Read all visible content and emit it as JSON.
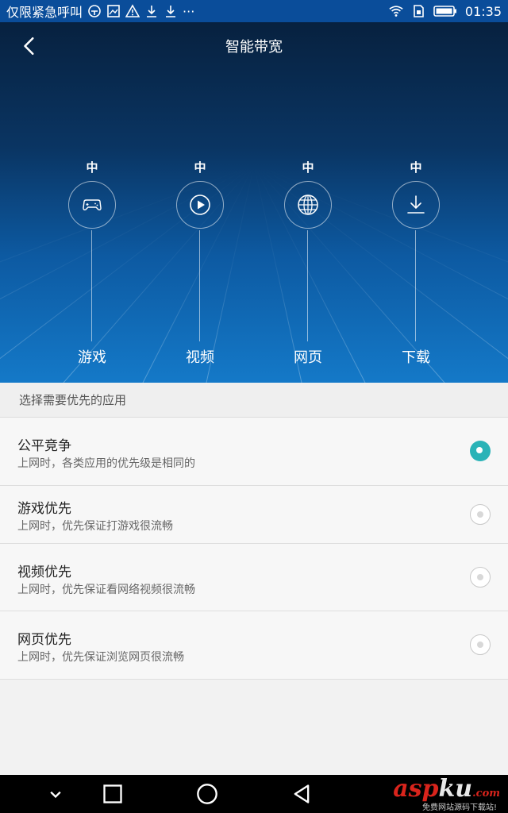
{
  "status_bar": {
    "left_text": "仅限紧急呼叫",
    "time": "01:35",
    "icons": [
      "location-icon",
      "image-icon",
      "warning-icon",
      "download-icon",
      "download-icon",
      "more-icon",
      "wifi-icon",
      "sim-icon",
      "battery-icon"
    ],
    "more": "···"
  },
  "header": {
    "title": "智能带宽",
    "back_icon": "chevron-left-icon"
  },
  "apps": [
    {
      "level": "中",
      "label": "游戏",
      "icon": "gamepad-icon"
    },
    {
      "level": "中",
      "label": "视频",
      "icon": "play-icon"
    },
    {
      "level": "中",
      "label": "网页",
      "icon": "globe-icon"
    },
    {
      "level": "中",
      "label": "下载",
      "icon": "download-icon"
    }
  ],
  "section": {
    "title": "选择需要优先的应用"
  },
  "options": [
    {
      "title": "公平竞争",
      "desc": "上网时，各类应用的优先级是相同的",
      "selected": true
    },
    {
      "title": "游戏优先",
      "desc": "上网时，优先保证打游戏很流畅",
      "selected": false
    },
    {
      "title": "视频优先",
      "desc": "上网时，优先保证看网络视频很流畅",
      "selected": false
    },
    {
      "title": "网页优先",
      "desc": "上网时，优先保证浏览网页很流畅",
      "selected": false
    }
  ],
  "nav": {
    "buttons": [
      "chevron-down-icon",
      "recents-icon",
      "home-icon",
      "back-icon"
    ]
  },
  "watermark": {
    "red": "asp",
    "grey": "ku",
    "suffix": ".com",
    "sub": "免费网站源码下载站!"
  },
  "colors": {
    "accent": "#2ab3b7",
    "hero_top": "#07213f",
    "hero_bottom": "#1479c8",
    "status_bar": "#0a4d9a"
  }
}
